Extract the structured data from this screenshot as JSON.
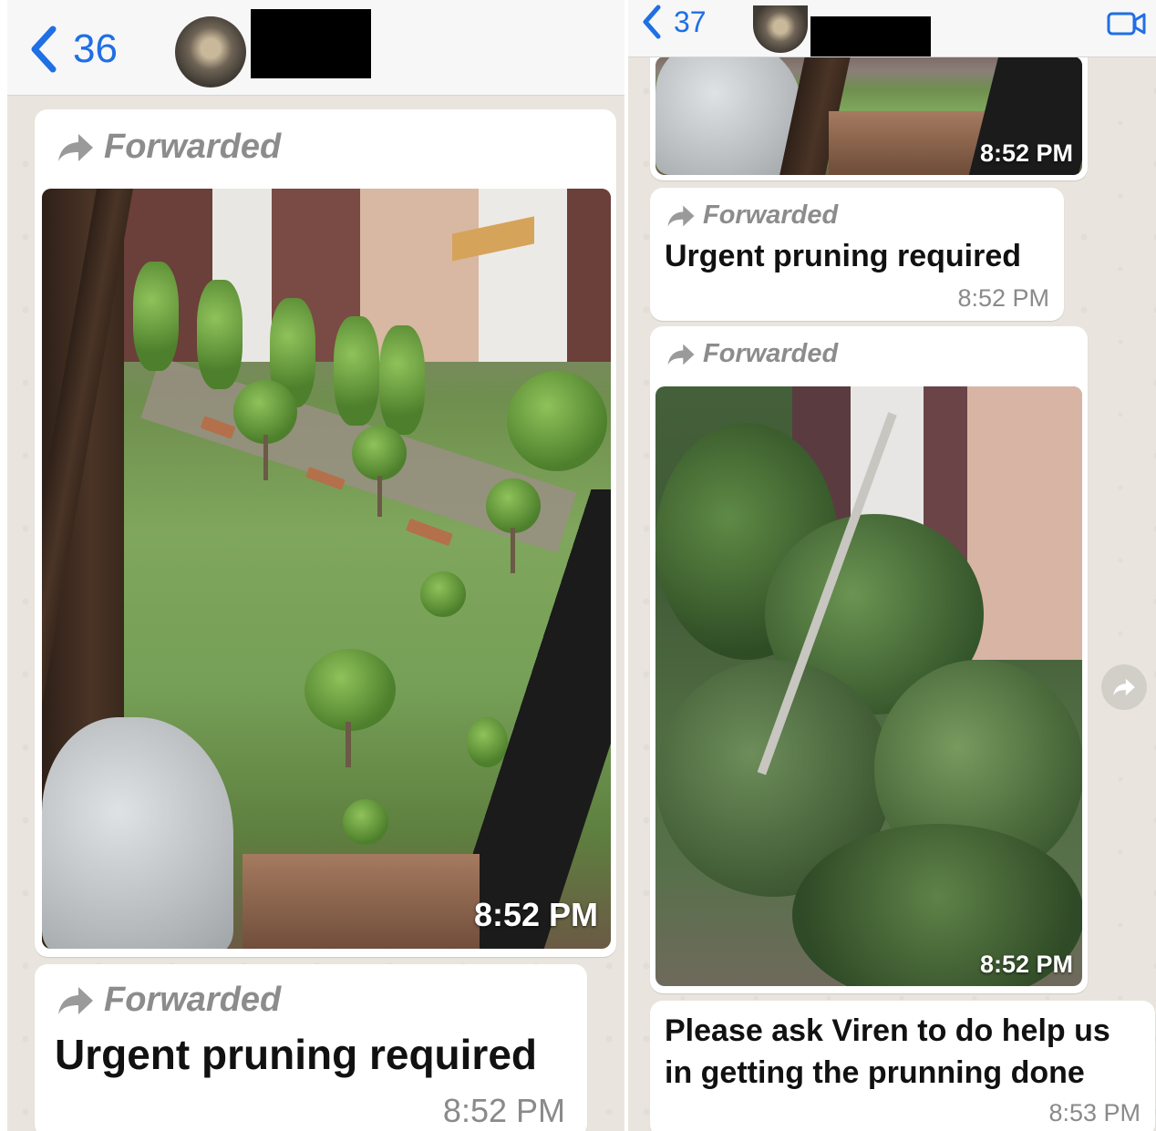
{
  "left": {
    "header": {
      "back_count": "36"
    },
    "bubbles": [
      {
        "forwarded_label": "Forwarded",
        "image_time": "8:52 PM"
      },
      {
        "forwarded_label": "Forwarded",
        "text": "Urgent pruning required",
        "time": "8:52 PM"
      }
    ]
  },
  "right": {
    "header": {
      "back_count": "37",
      "icons": [
        "chevron-left-icon",
        "video-call-icon"
      ]
    },
    "bubbles": [
      {
        "image_time": "8:52 PM"
      },
      {
        "forwarded_label": "Forwarded",
        "text": "Urgent pruning required",
        "time": "8:52 PM"
      },
      {
        "forwarded_label": "Forwarded",
        "image_time": "8:52 PM"
      },
      {
        "text_line1": "Please ask Viren to do help us",
        "text_line2": "in getting the prunning done",
        "time": "8:53 PM"
      }
    ]
  },
  "colors": {
    "accent": "#1f6fe5",
    "chat_background": "#e9e5de",
    "bubble": "#ffffff"
  }
}
